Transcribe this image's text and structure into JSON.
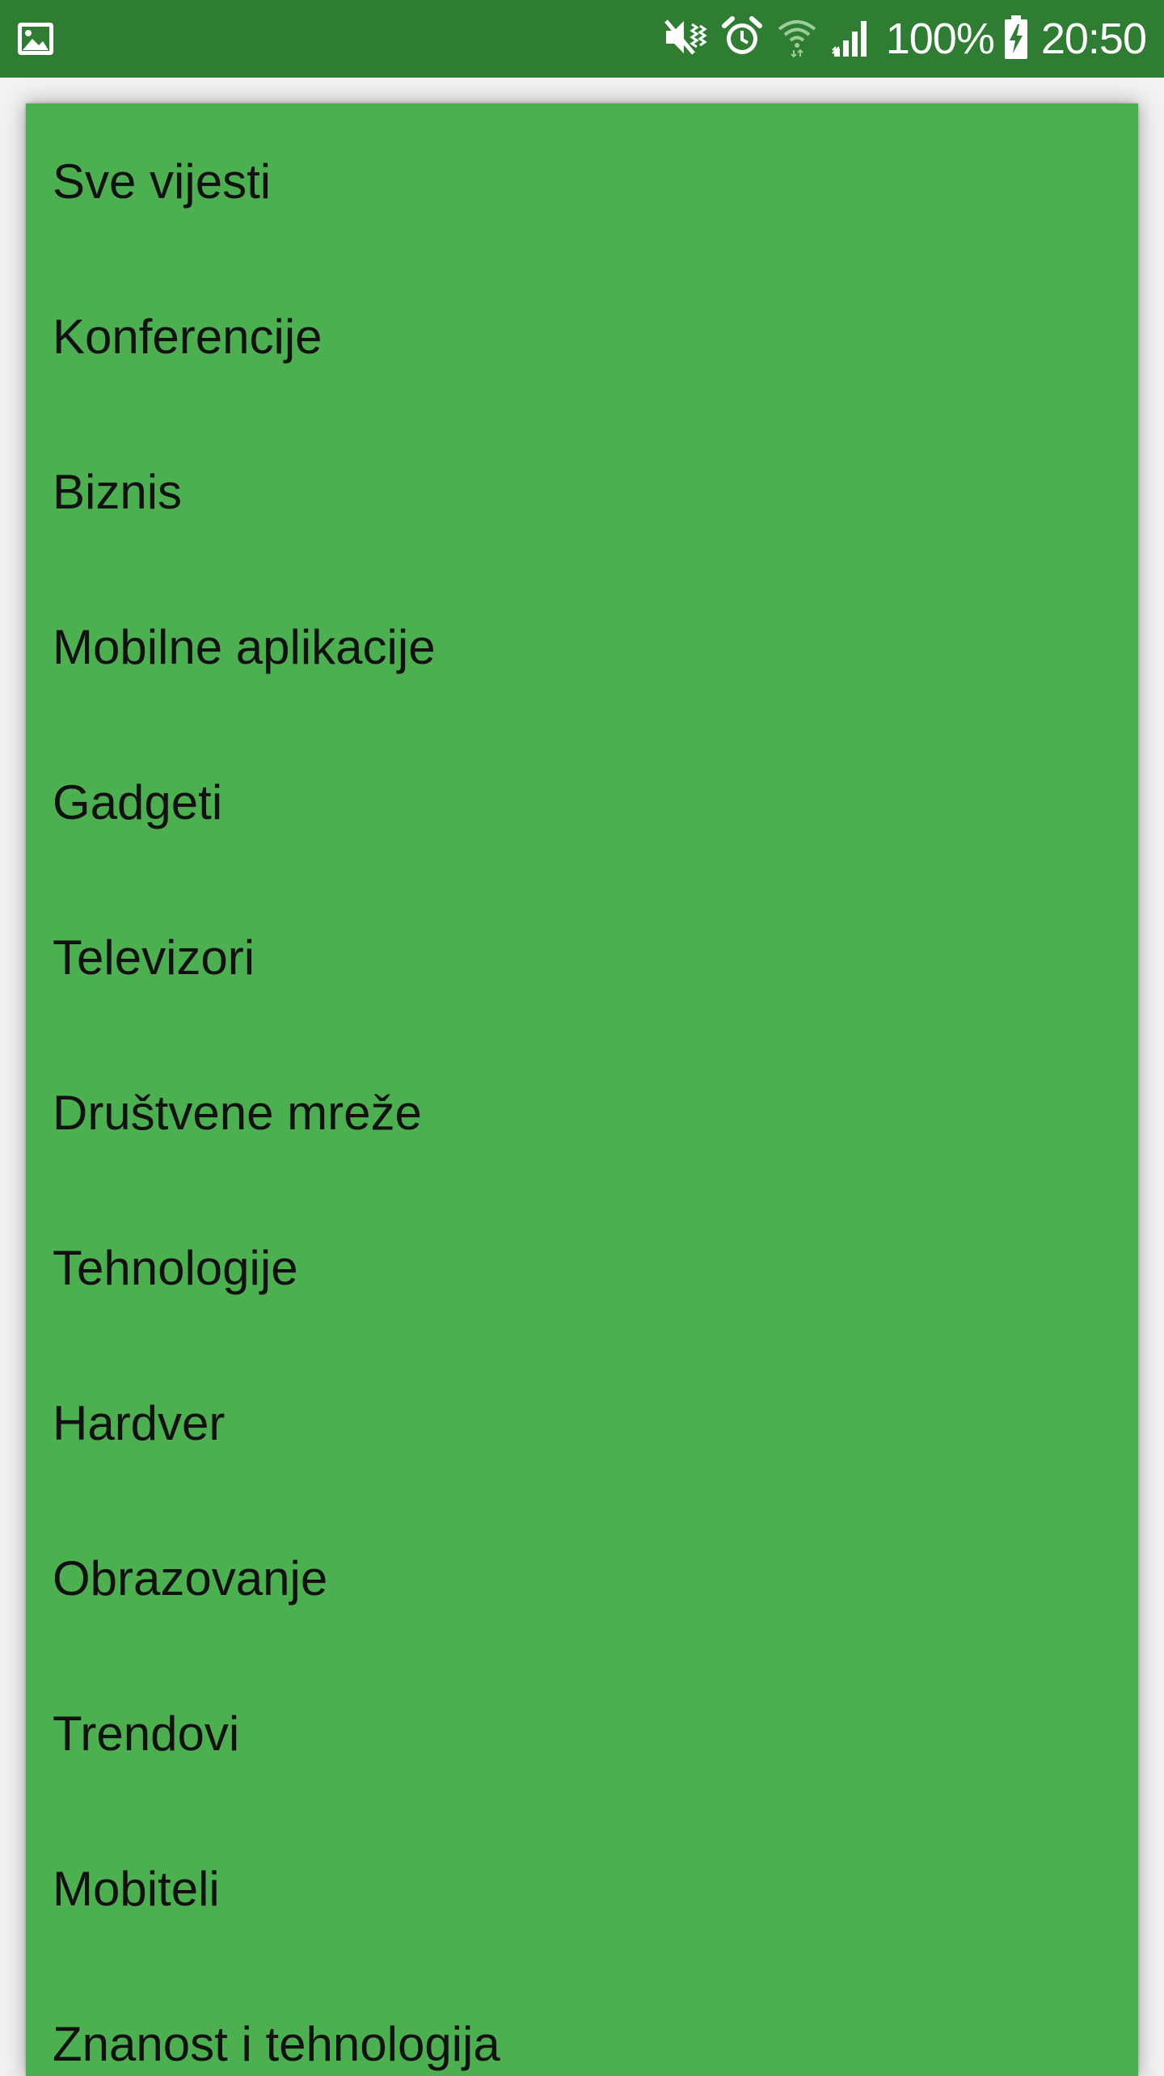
{
  "status_bar": {
    "left_icon": "image-notification-icon",
    "icons": [
      "mute-vibrate-icon",
      "alarm-icon",
      "wifi-icon",
      "signal-icon",
      "battery-charging-icon"
    ],
    "battery_percent": "100%",
    "time": "20:50",
    "background_color": "#2e7d32"
  },
  "menu": {
    "background_color": "#4caf50",
    "items": [
      {
        "label": "Sve vijesti"
      },
      {
        "label": "Konferencije"
      },
      {
        "label": "Biznis"
      },
      {
        "label": "Mobilne aplikacije"
      },
      {
        "label": "Gadgeti"
      },
      {
        "label": "Televizori"
      },
      {
        "label": "Društvene mreže"
      },
      {
        "label": "Tehnologije"
      },
      {
        "label": "Hardver"
      },
      {
        "label": "Obrazovanje"
      },
      {
        "label": "Trendovi"
      },
      {
        "label": "Mobiteli"
      },
      {
        "label": "Znanost i tehnologija"
      }
    ]
  }
}
